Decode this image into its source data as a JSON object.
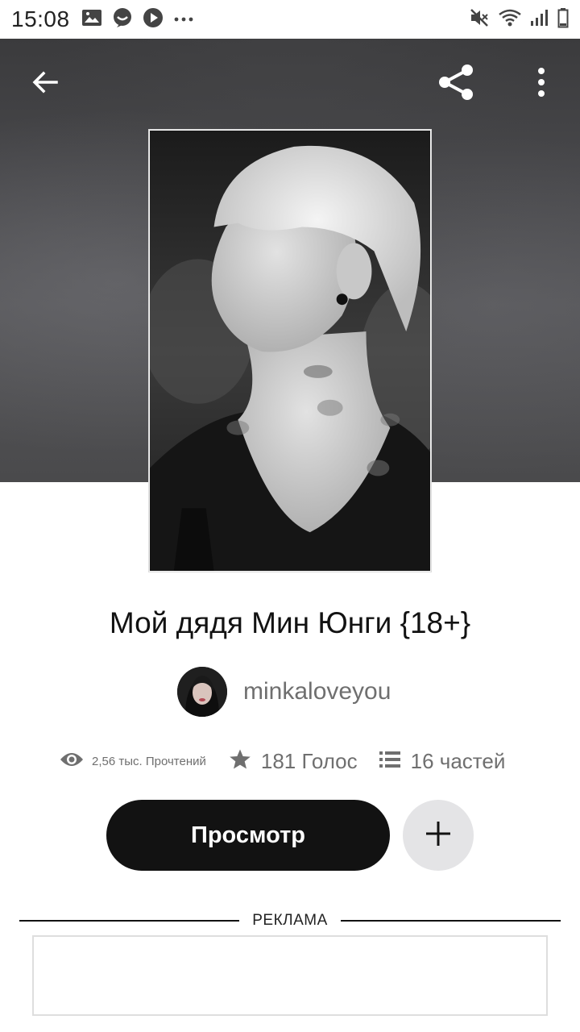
{
  "status_bar": {
    "time": "15:08"
  },
  "story": {
    "title": "Мой дядя Мин Юнги {18+}",
    "author": "minkaloveyou",
    "cover_description_icon": "cover-image",
    "stats": {
      "reads": "2,56 тыс. Прочтений",
      "votes": "181 Голос",
      "parts": "16 частей"
    }
  },
  "actions": {
    "read_label": "Просмотр",
    "add_icon": "plus-icon"
  },
  "ad": {
    "label": "РЕКЛАМА"
  },
  "colors": {
    "primary_button": "#121212",
    "add_button": "#e4e4e6",
    "hero_background": "#47474a",
    "muted_text": "#6f6f6f"
  },
  "icons": {
    "back": "arrow-left-icon",
    "share": "share-icon",
    "more": "more-vertical-icon",
    "reads": "eye-icon",
    "votes": "star-icon",
    "parts": "list-icon"
  }
}
